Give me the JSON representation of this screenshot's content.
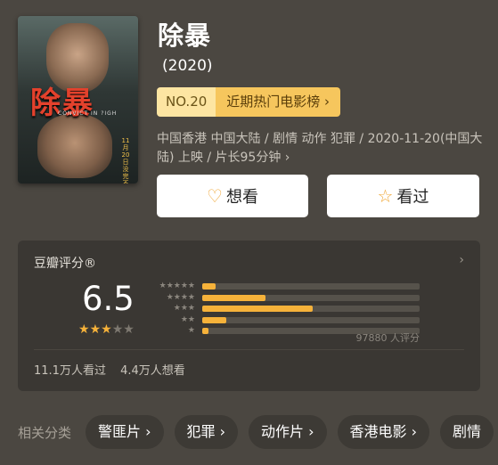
{
  "poster": {
    "title_art": "除暴",
    "subtitle_art": "CONVICT IN ?IGH",
    "date_art": "11月20日 没完不放"
  },
  "movie": {
    "title": "除暴",
    "year": "(2020)",
    "rank_no": "NO.20",
    "rank_label": "近期热门电影榜 ›",
    "meta": "中国香港 中国大陆 / 剧情 动作 犯罪 / 2020-11-20(中国大陆) 上映 / 片长95分钟 ›"
  },
  "actions": {
    "want_icon": "♡",
    "want_label": "想看",
    "seen_icon": "☆",
    "seen_label": "看过"
  },
  "rating": {
    "header": "豆瓣评分®",
    "arrow": "›",
    "score": "6.5",
    "stars_filled": 3,
    "stars_total": 5,
    "distribution": [
      {
        "stars": 5,
        "label": "★★★★★",
        "fraction": 0.06
      },
      {
        "stars": 4,
        "label": "★★★★",
        "fraction": 0.29
      },
      {
        "stars": 3,
        "label": "★★★",
        "fraction": 0.51
      },
      {
        "stars": 2,
        "label": "★★",
        "fraction": 0.11
      },
      {
        "stars": 1,
        "label": "★",
        "fraction": 0.03
      }
    ],
    "votes": "97880 人评分",
    "seen": "11.1万人看过",
    "want": "4.4万人想看"
  },
  "categories": {
    "label": "相关分类",
    "items": [
      "警匪片 ›",
      "犯罪 ›",
      "动作片 ›",
      "香港电影 ›",
      "剧情"
    ]
  },
  "colors": {
    "background": "#4b4741",
    "accent": "#f6b23a",
    "rank_bg": "#f6c65d"
  }
}
